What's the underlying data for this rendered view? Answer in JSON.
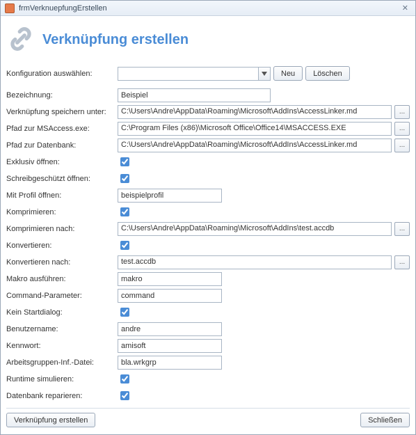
{
  "window": {
    "title": "frmVerknuepfungErstellen"
  },
  "header": {
    "title": "Verknüpfung erstellen"
  },
  "config": {
    "label": "Konfiguration auswählen:",
    "value": "",
    "new_btn": "Neu",
    "delete_btn": "Löschen"
  },
  "rows": {
    "bezeichnung": {
      "label": "Bezeichnung:",
      "value": "Beispiel"
    },
    "speichern": {
      "label": "Verknüpfung speichern unter:",
      "value": "C:\\Users\\Andre\\AppData\\Roaming\\Microsoft\\AddIns\\AccessLinker.md"
    },
    "msaccess": {
      "label": "Pfad zur MSAccess.exe:",
      "value": "C:\\Program Files (x86)\\Microsoft Office\\Office14\\MSACCESS.EXE"
    },
    "datenbank": {
      "label": "Pfad zur Datenbank:",
      "value": "C:\\Users\\Andre\\AppData\\Roaming\\Microsoft\\AddIns\\AccessLinker.md"
    },
    "exklusiv": {
      "label": "Exklusiv öffnen:",
      "checked": true
    },
    "schreibschutz": {
      "label": "Schreibgeschützt öffnen:",
      "checked": true
    },
    "profil": {
      "label": "Mit Profil öffnen:",
      "value": "beispielprofil"
    },
    "komprimieren": {
      "label": "Komprimieren:",
      "checked": true
    },
    "komprimieren_nach": {
      "label": "Komprimieren nach:",
      "value": "C:\\Users\\Andre\\AppData\\Roaming\\Microsoft\\AddIns\\test.accdb"
    },
    "konvertieren": {
      "label": "Konvertieren:",
      "checked": true
    },
    "konvertieren_nach": {
      "label": "Konvertieren nach:",
      "value": "test.accdb"
    },
    "makro": {
      "label": "Makro ausführen:",
      "value": "makro"
    },
    "command": {
      "label": "Command-Parameter:",
      "value": "command"
    },
    "startdialog": {
      "label": "Kein Startdialog:",
      "checked": true
    },
    "benutzer": {
      "label": "Benutzername:",
      "value": "andre"
    },
    "kennwort": {
      "label": "Kennwort:",
      "value": "amisoft"
    },
    "wrkgrp": {
      "label": "Arbeitsgruppen-Inf.-Datei:",
      "value": "bla.wrkgrp"
    },
    "runtime": {
      "label": "Runtime simulieren:",
      "checked": true
    },
    "repair": {
      "label": "Datenbank reparieren:",
      "checked": true
    }
  },
  "bottom": {
    "create": "Verknüpfung erstellen",
    "close": "Schließen"
  },
  "browse_glyph": "..."
}
